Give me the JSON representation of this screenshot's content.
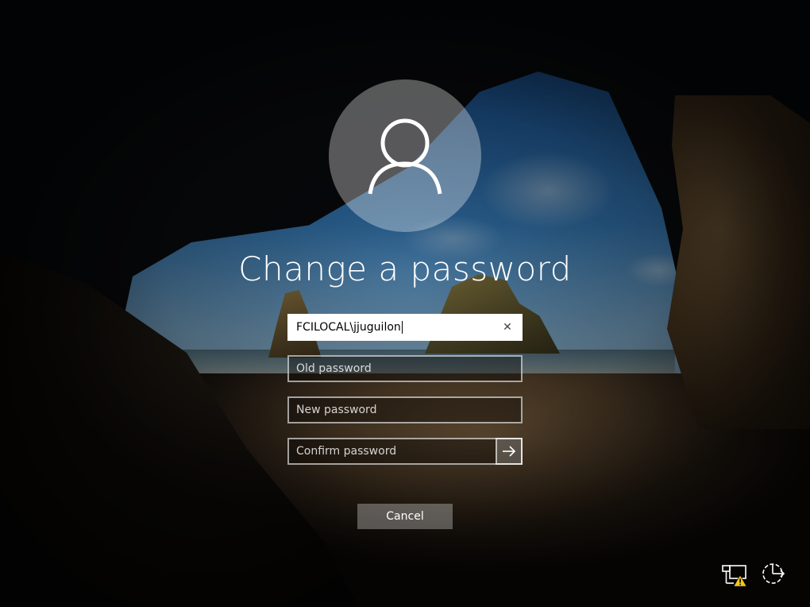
{
  "title": "Change a password",
  "form": {
    "username": {
      "value": "FCILOCAL\\jjuguilon"
    },
    "old_password": {
      "placeholder": "Old password"
    },
    "new_password": {
      "placeholder": "New password"
    },
    "confirm_password": {
      "placeholder": "Confirm password"
    }
  },
  "cancel_label": "Cancel",
  "icons": {
    "avatar": "user-icon",
    "clear": "close-icon",
    "submit": "arrow-right-icon",
    "network": "network-warning-icon",
    "ease_of_access": "ease-of-access-icon"
  },
  "colors": {
    "warning": "#f5c518"
  }
}
